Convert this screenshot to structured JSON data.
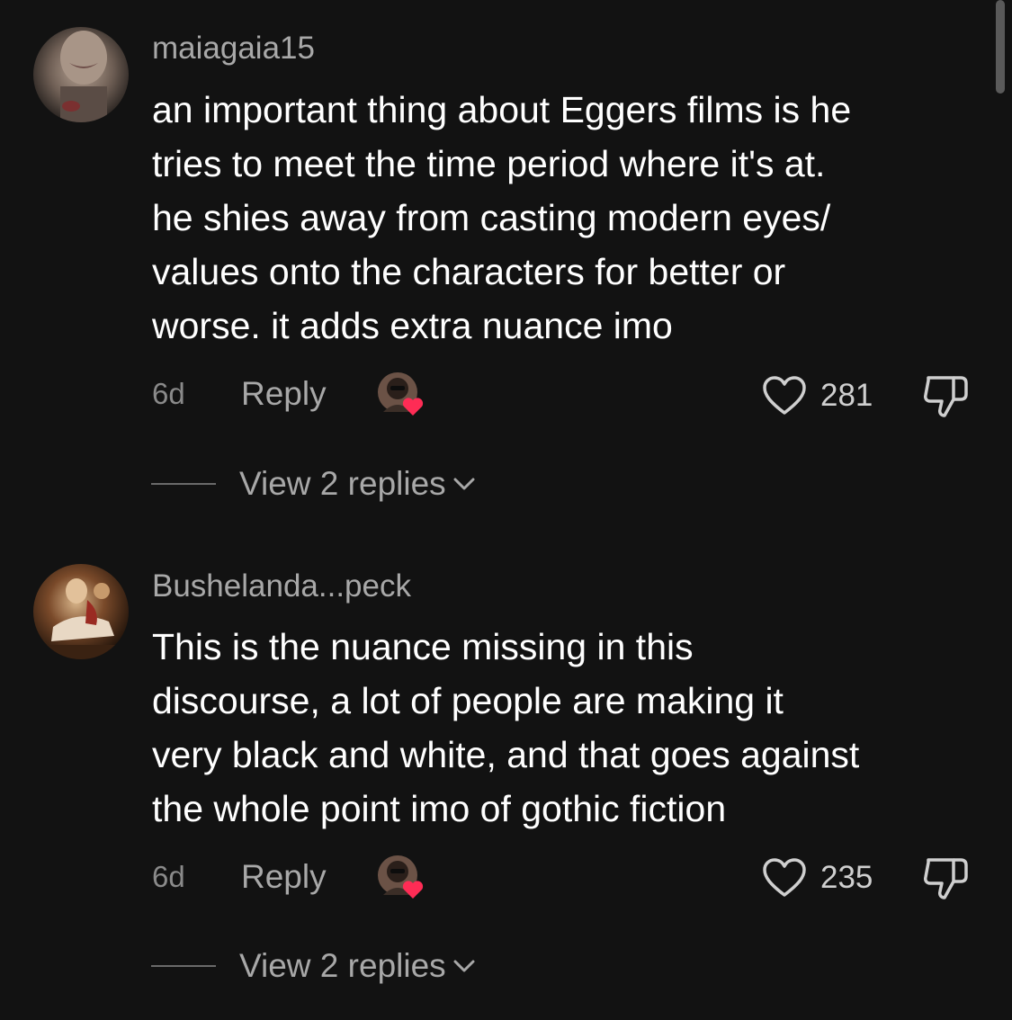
{
  "colors": {
    "background": "#121212",
    "text_primary": "#ffffff",
    "text_secondary": "#a8a8a8",
    "creator_heart": "#fe2c55"
  },
  "comments": [
    {
      "username": "maiagaia15",
      "lines": [
        "an important thing about Eggers films is he",
        "tries to meet the time period where it's at.",
        "he shies away from casting modern eyes/",
        "values onto the characters for better or",
        "worse. it adds extra nuance imo"
      ],
      "time": "6d",
      "reply_label": "Reply",
      "like_count": "281",
      "view_replies_label": "View 2 replies",
      "icons": {
        "like": "heart-outline-icon",
        "dislike": "thumbs-down-icon",
        "creator_like": "creator-liked-heart-icon",
        "expand": "chevron-down-icon"
      }
    },
    {
      "username": "Bushelanda...peck",
      "lines": [
        "This is the nuance missing in this",
        "discourse, a lot of people are making it",
        "very black and white, and that goes against",
        "the whole point imo of gothic fiction"
      ],
      "time": "6d",
      "reply_label": "Reply",
      "like_count": "235",
      "view_replies_label": "View 2 replies",
      "icons": {
        "like": "heart-outline-icon",
        "dislike": "thumbs-down-icon",
        "creator_like": "creator-liked-heart-icon",
        "expand": "chevron-down-icon"
      }
    }
  ]
}
